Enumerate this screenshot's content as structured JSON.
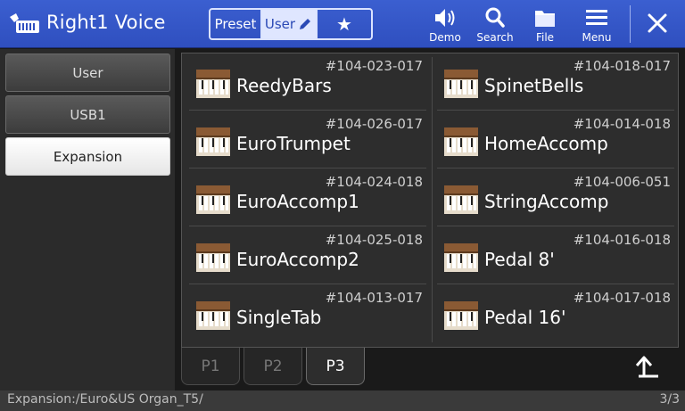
{
  "header": {
    "title": "Right1 Voice",
    "tabs": {
      "preset": "Preset",
      "user": "User",
      "favorite": "★"
    },
    "tools": [
      {
        "key": "demo",
        "label": "Demo",
        "icon": "speaker-icon"
      },
      {
        "key": "search",
        "label": "Search",
        "icon": "search-icon"
      },
      {
        "key": "file",
        "label": "File",
        "icon": "folder-icon"
      },
      {
        "key": "menu",
        "label": "Menu",
        "icon": "menu-icon"
      }
    ],
    "close_icon": "close-icon"
  },
  "sidebar": {
    "items": [
      {
        "label": "User",
        "active": false
      },
      {
        "label": "USB1",
        "active": false
      },
      {
        "label": "Expansion",
        "active": true
      }
    ]
  },
  "voices": [
    {
      "number": "#104-023-017",
      "name": "ReedyBars"
    },
    {
      "number": "#104-018-017",
      "name": "SpinetBells"
    },
    {
      "number": "#104-026-017",
      "name": "EuroTrumpet"
    },
    {
      "number": "#104-014-018",
      "name": "HomeAccomp"
    },
    {
      "number": "#104-024-018",
      "name": "EuroAccomp1"
    },
    {
      "number": "#104-006-051",
      "name": "StringAccomp"
    },
    {
      "number": "#104-025-018",
      "name": "EuroAccomp2"
    },
    {
      "number": "#104-016-018",
      "name": "Pedal 8'"
    },
    {
      "number": "#104-013-017",
      "name": "SingleTab"
    },
    {
      "number": "#104-017-018",
      "name": "Pedal 16'"
    }
  ],
  "pages": {
    "tabs": [
      "P1",
      "P2",
      "P3"
    ],
    "active": "P3",
    "up_icon": "up-arrow-icon"
  },
  "status": {
    "path": "Expansion:/Euro&US Organ_T5/",
    "page": "3/3"
  },
  "colors": {
    "header": "#3b5fd0",
    "active_tab": "#dfe6ff",
    "background": "#1a1a1a"
  }
}
